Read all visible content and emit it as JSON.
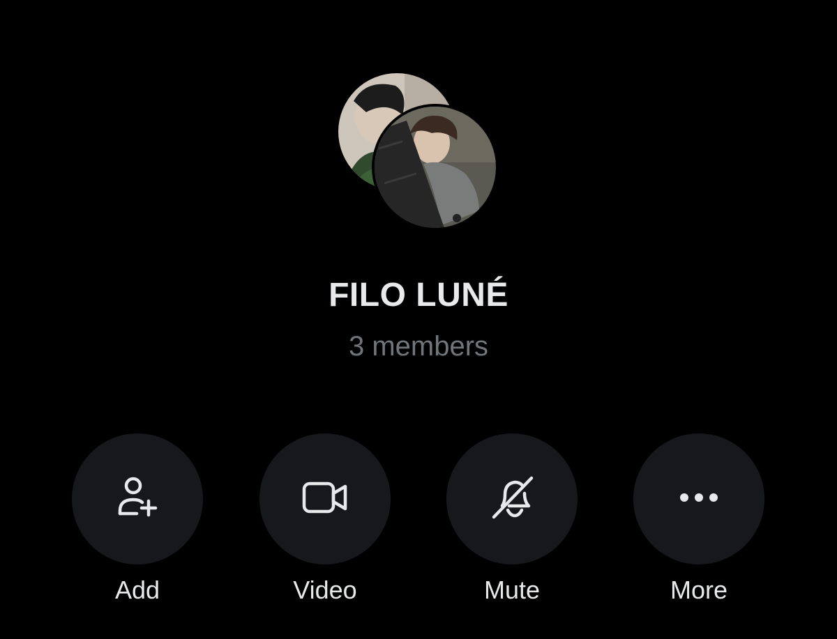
{
  "group": {
    "name": "FILO LUNÉ",
    "members": "3 members",
    "avatars": [
      {
        "name": "member-avatar-1"
      },
      {
        "name": "member-avatar-2"
      }
    ]
  },
  "actions": [
    {
      "label": "Add",
      "icon": "add-person-icon"
    },
    {
      "label": "Video",
      "icon": "video-camera-icon"
    },
    {
      "label": "Mute",
      "icon": "bell-slash-icon"
    },
    {
      "label": "More",
      "icon": "more-horizontal-icon"
    }
  ],
  "colors": {
    "background": "#000000",
    "button_bg": "#16181c",
    "text_primary": "#e7e9ea",
    "text_secondary": "#71767b"
  }
}
